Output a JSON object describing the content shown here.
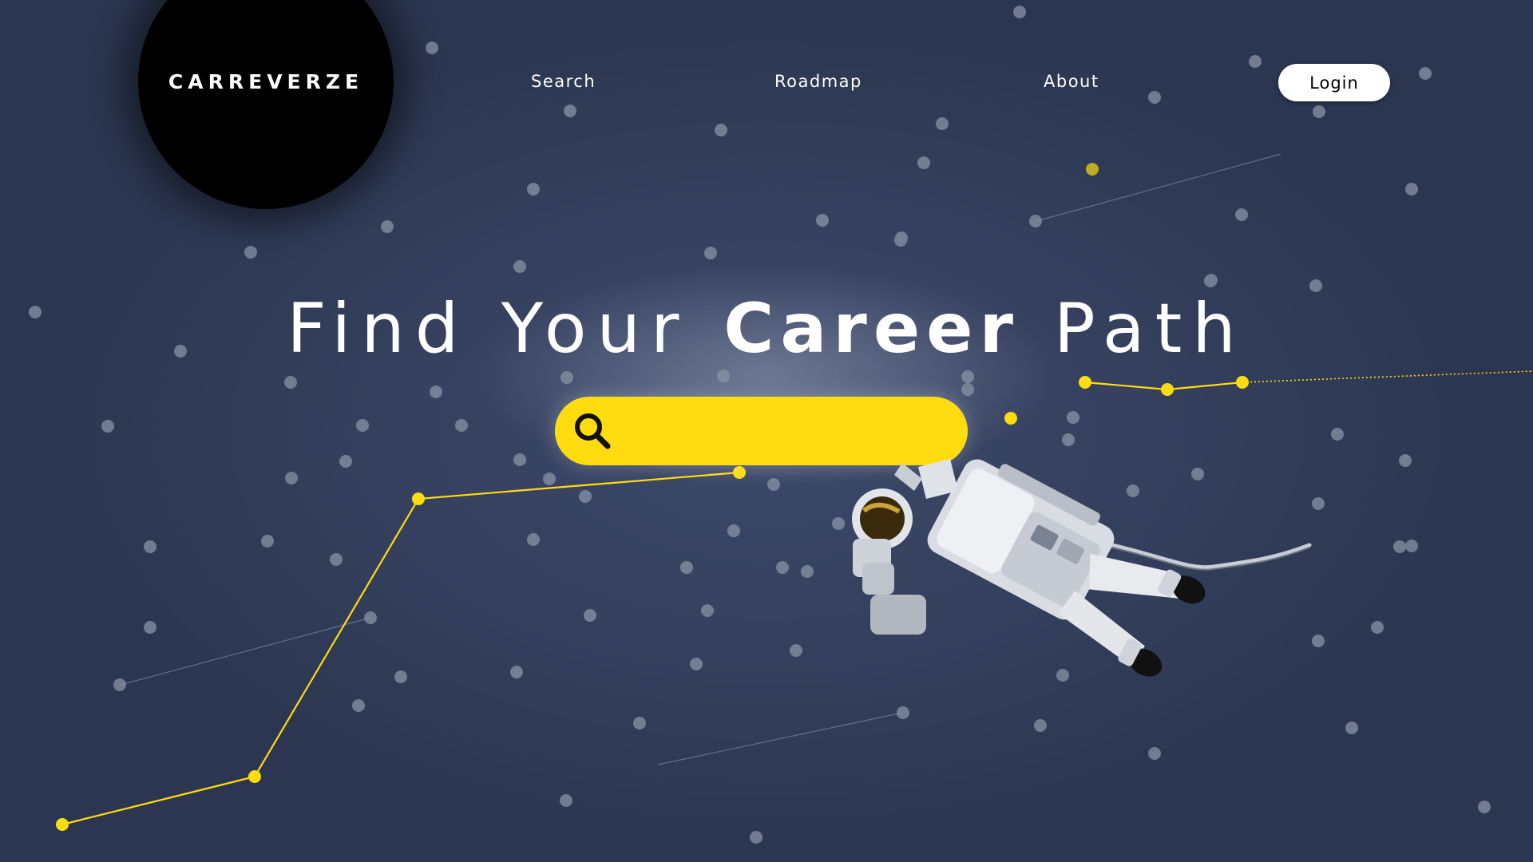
{
  "header": {
    "logo": "CARREVERZE",
    "nav": [
      {
        "label": "Search"
      },
      {
        "label": "Roadmap"
      },
      {
        "label": "About"
      }
    ],
    "login_label": "Login"
  },
  "hero": {
    "title_before": "Find Your",
    "title_bold": "Career",
    "title_after": "Path"
  },
  "search": {
    "value": "",
    "placeholder": ""
  },
  "theme": {
    "background": "#34405d",
    "accent_yellow": "#fedc10",
    "star_color": "#7b8497"
  },
  "icons": [
    "search-icon",
    "astronaut-illustration",
    "constellation-lines"
  ]
}
